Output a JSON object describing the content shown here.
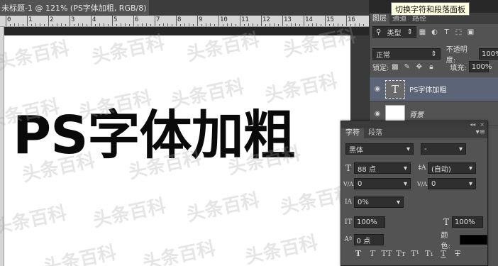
{
  "document": {
    "tab_title": "未标题-1 @ 121% (PS字体加粗, RGB/8) *",
    "close_glyph": "×",
    "canvas_text": "PS字体加粗",
    "ruler_numbers": [
      "0",
      "1",
      "2",
      "3",
      "4",
      "5",
      "6",
      "7",
      "8",
      "9",
      "10",
      "11",
      "12",
      "13",
      "14",
      "15",
      "16"
    ]
  },
  "watermark": {
    "text": "头条百科"
  },
  "tooltip": {
    "text": "切换字符和段落面板"
  },
  "layers_panel": {
    "tabs": [
      "图层",
      "通道",
      "路径"
    ],
    "filter_label": "类型",
    "blend_mode": "正常",
    "opacity_label": "不透明度:",
    "opacity_value": "100%",
    "lock_label": "锁定:",
    "fill_label": "填充:",
    "fill_value": "100%",
    "layers": [
      {
        "name": "PS字体加粗",
        "thumb": "T"
      },
      {
        "name": "背景",
        "thumb": ""
      }
    ]
  },
  "character_panel": {
    "tabs": [
      "字符",
      "段落"
    ],
    "collapse_glyph": "◂◂",
    "close_glyph": "×",
    "menu_glyph": "▾≡",
    "font_family": "黑体",
    "font_style": "-",
    "font_size": "88 点",
    "leading": "(自动)",
    "kerning": "0",
    "tracking": "0",
    "scale_percent": "0%",
    "vertical_scale": "100%",
    "horizontal_scale": "100%",
    "baseline_shift": "0 点",
    "color_label": "颜色:",
    "color": "#000000",
    "style_buttons": [
      "T",
      "T",
      "TT",
      "Tт",
      "T¹",
      "T₁",
      "T",
      "T"
    ]
  },
  "icons": {
    "size": "T",
    "leading": "‡A",
    "kerning": "V/A",
    "tracking": "V/A",
    "scale": "IA",
    "vscale": "IT",
    "hscale": "T",
    "baseline": "Aª"
  }
}
